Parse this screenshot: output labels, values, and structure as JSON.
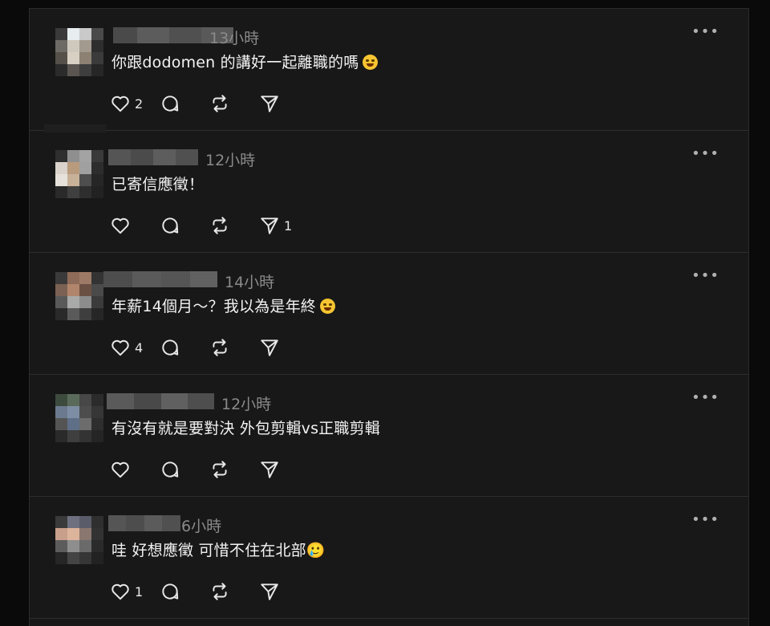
{
  "more_label": "•••",
  "comments": [
    {
      "time": "13小時",
      "text": "你跟dodomen 的講好一起離職的嗎",
      "emoji": "grinning-sweat-emoji",
      "likes": "2",
      "replies": "",
      "reposts": "",
      "shares": ""
    },
    {
      "time": "12小時",
      "text": "已寄信應徵！",
      "emoji": "",
      "likes": "",
      "replies": "",
      "reposts": "",
      "shares": "1"
    },
    {
      "time": "14小時",
      "text": "年薪14個月～？我以為是年終",
      "emoji": "rofl-emoji",
      "likes": "4",
      "replies": "",
      "reposts": "",
      "shares": ""
    },
    {
      "time": "12小時",
      "text": "有沒有就是要對決 外包剪輯vs正職剪輯",
      "emoji": "",
      "likes": "",
      "replies": "",
      "reposts": "",
      "shares": ""
    },
    {
      "time": "6小時",
      "text": "哇 好想應徵 可惜不住在北部🥲",
      "emoji": "",
      "likes": "1",
      "replies": "",
      "reposts": "",
      "shares": ""
    }
  ],
  "colors": {
    "background": "#181818",
    "text": "#f3f3f3",
    "muted": "#8a8a8a",
    "divider": "#2e2e2e",
    "emoji": "#f7c531"
  }
}
